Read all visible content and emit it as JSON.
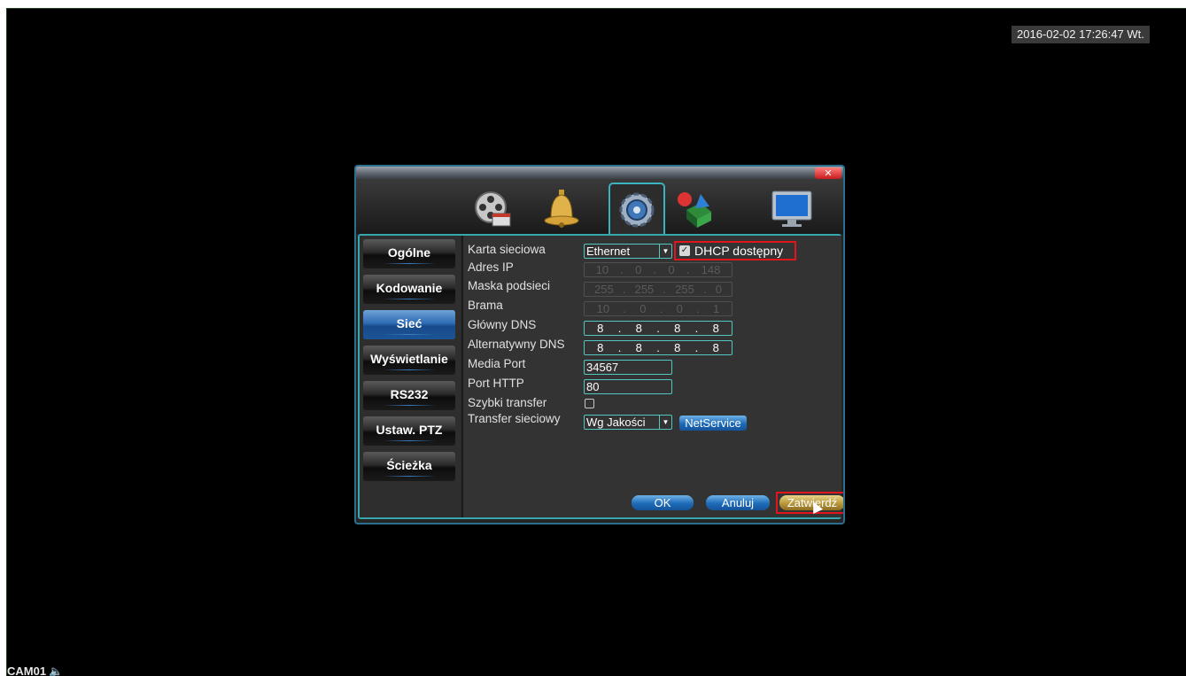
{
  "overlay": {
    "datetime": "2016-02-02 17:26:47 Wt.",
    "camera_label": "CAM01"
  },
  "dialog": {
    "close_label": "✕",
    "tabs": [
      {
        "name": "record-icon",
        "active": false
      },
      {
        "name": "alarm-bell-icon",
        "active": false
      },
      {
        "name": "system-gear-icon",
        "active": true
      },
      {
        "name": "tools-icon",
        "active": false
      },
      {
        "name": "monitor-icon",
        "active": false
      }
    ],
    "sidebar": [
      {
        "label": "Ogólne",
        "active": false
      },
      {
        "label": "Kodowanie",
        "active": false
      },
      {
        "label": "Sieć",
        "active": true
      },
      {
        "label": "Wyświetlanie",
        "active": false
      },
      {
        "label": "RS232",
        "active": false
      },
      {
        "label": "Ustaw. PTZ",
        "active": false
      },
      {
        "label": "Ścieżka",
        "active": false
      }
    ],
    "form": {
      "labels": {
        "network_card": "Karta sieciowa",
        "ip_address": "Adres IP",
        "subnet_mask": "Maska podsieci",
        "gateway": "Brama",
        "primary_dns": "Główny DNS",
        "alternate_dns": "Alternatywny DNS",
        "media_port": "Media Port",
        "http_port": "Port HTTP",
        "fast_transfer": "Szybki transfer",
        "network_transfer": "Transfer sieciowy"
      },
      "network_card_value": "Ethernet",
      "dhcp_label": "DHCP dostępny",
      "dhcp_checked": true,
      "ip_address": [
        "10",
        "0",
        "0",
        "148"
      ],
      "subnet_mask": [
        "255",
        "255",
        "255",
        "0"
      ],
      "gateway": [
        "10",
        "0",
        "0",
        "1"
      ],
      "primary_dns": [
        "8",
        "8",
        "8",
        "8"
      ],
      "alternate_dns": [
        "8",
        "8",
        "8",
        "8"
      ],
      "media_port": "34567",
      "http_port": "80",
      "fast_transfer_checked": false,
      "network_transfer_value": "Wg Jakości",
      "netservice_label": "NetService"
    },
    "buttons": {
      "ok": "OK",
      "cancel": "Anuluj",
      "apply": "Zatwierdź"
    }
  }
}
